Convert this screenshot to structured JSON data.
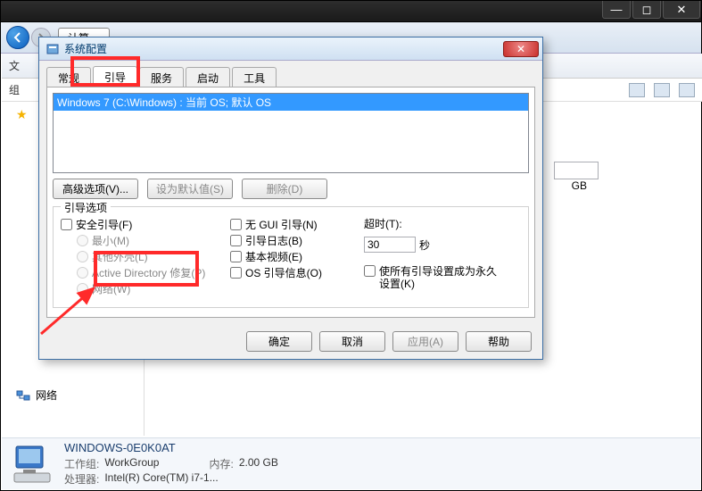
{
  "titlebar": {
    "min": "—",
    "max": "◻",
    "close": "✕"
  },
  "nav": {
    "breadcrumb_stub": "计算…"
  },
  "menubar": {
    "file_stub": "文",
    "org_stub": "组"
  },
  "stray": {
    "gb": "GB"
  },
  "sidebar": {
    "network": "网络"
  },
  "footer": {
    "pc_name": "WINDOWS-0E0K0AT",
    "workgroup_label": "工作组:",
    "workgroup_value": "WorkGroup",
    "cpu_label": "处理器:",
    "cpu_value": "Intel(R) Core(TM) i7-1...",
    "mem_label": "内存:",
    "mem_value": "2.00 GB"
  },
  "dialog": {
    "title": "系统配置",
    "tabs": {
      "general": "常规",
      "boot": "引导",
      "services": "服务",
      "startup": "启动",
      "tools": "工具"
    },
    "os_entry": "Windows 7 (C:\\Windows) : 当前 OS; 默认 OS",
    "buttons": {
      "advanced": "高级选项(V)...",
      "setdefault": "设为默认值(S)",
      "delete": "删除(D)"
    },
    "group_label": "引导选项",
    "opts": {
      "safe": "安全引导(F)",
      "minimal": "最小(M)",
      "altshell": "其他外壳(L)",
      "ad": "Active Directory 修复(P)",
      "network": "网络(W)",
      "nogui": "无 GUI 引导(N)",
      "bootlog": "引导日志(B)",
      "basevideo": "基本视频(E)",
      "osinfo": "OS 引导信息(O)"
    },
    "timeout_label": "超时(T):",
    "timeout_value": "30",
    "timeout_unit": "秒",
    "permanent": "使所有引导设置成为永久设置(K)",
    "dlg_buttons": {
      "ok": "确定",
      "cancel": "取消",
      "apply": "应用(A)",
      "help": "帮助"
    }
  }
}
